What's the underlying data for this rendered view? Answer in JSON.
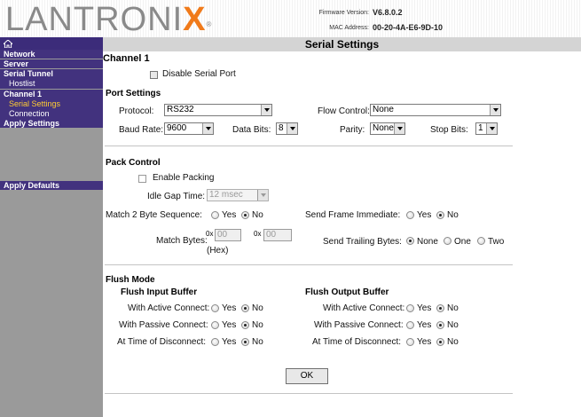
{
  "header": {
    "logo_main": "LANTRONI",
    "logo_x": "X",
    "logo_reg": "®",
    "firmware_label": "Firmware Version:",
    "firmware_value": "V6.8.0.2",
    "mac_label": "MAC Address:",
    "mac_value": "00-20-4A-E6-9D-10"
  },
  "sidebar": {
    "items": [
      {
        "label": "Network"
      },
      {
        "label": "Server"
      },
      {
        "label": "Serial Tunnel"
      },
      {
        "label": "Hostlist"
      },
      {
        "label": "Channel 1"
      },
      {
        "label": "Serial Settings"
      },
      {
        "label": "Connection"
      },
      {
        "label": "Apply Settings"
      }
    ],
    "apply_defaults": "Apply Defaults"
  },
  "page_title": "Serial Settings",
  "channel": {
    "title": "Channel 1",
    "disable_serial_port": "Disable Serial Port"
  },
  "port_settings": {
    "title": "Port Settings",
    "protocol_label": "Protocol:",
    "protocol_value": "RS232",
    "flow_control_label": "Flow Control:",
    "flow_control_value": "None",
    "baud_rate_label": "Baud Rate:",
    "baud_rate_value": "9600",
    "data_bits_label": "Data Bits:",
    "data_bits_value": "8",
    "parity_label": "Parity:",
    "parity_value": "None",
    "stop_bits_label": "Stop Bits:",
    "stop_bits_value": "1"
  },
  "pack_control": {
    "title": "Pack Control",
    "enable_packing": "Enable Packing",
    "idle_gap_label": "Idle Gap Time:",
    "idle_gap_value": "12 msec",
    "match2_label": "Match 2 Byte Sequence:",
    "send_frame_label": "Send Frame Immediate:",
    "match_bytes_label": "Match Bytes:",
    "hex_prefix": "0x",
    "match_byte_1": "00",
    "match_byte_2": "00",
    "hex_note": "(Hex)",
    "send_trailing_label": "Send Trailing Bytes:",
    "opt_yes": "Yes",
    "opt_no": "No",
    "opt_none": "None",
    "opt_one": "One",
    "opt_two": "Two"
  },
  "flush_mode": {
    "title": "Flush Mode",
    "input_title": "Flush Input Buffer",
    "output_title": "Flush Output Buffer",
    "active_connect": "With Active Connect:",
    "passive_connect": "With Passive Connect:",
    "at_disconnect": "At Time of Disconnect:",
    "opt_yes": "Yes",
    "opt_no": "No"
  },
  "ok_label": "OK",
  "colors": {
    "nav_bg": "#42327e",
    "sidebar_bg": "#9a9a9a",
    "active_nav": "#ffcc33",
    "logo_accent": "#f07a1a"
  }
}
